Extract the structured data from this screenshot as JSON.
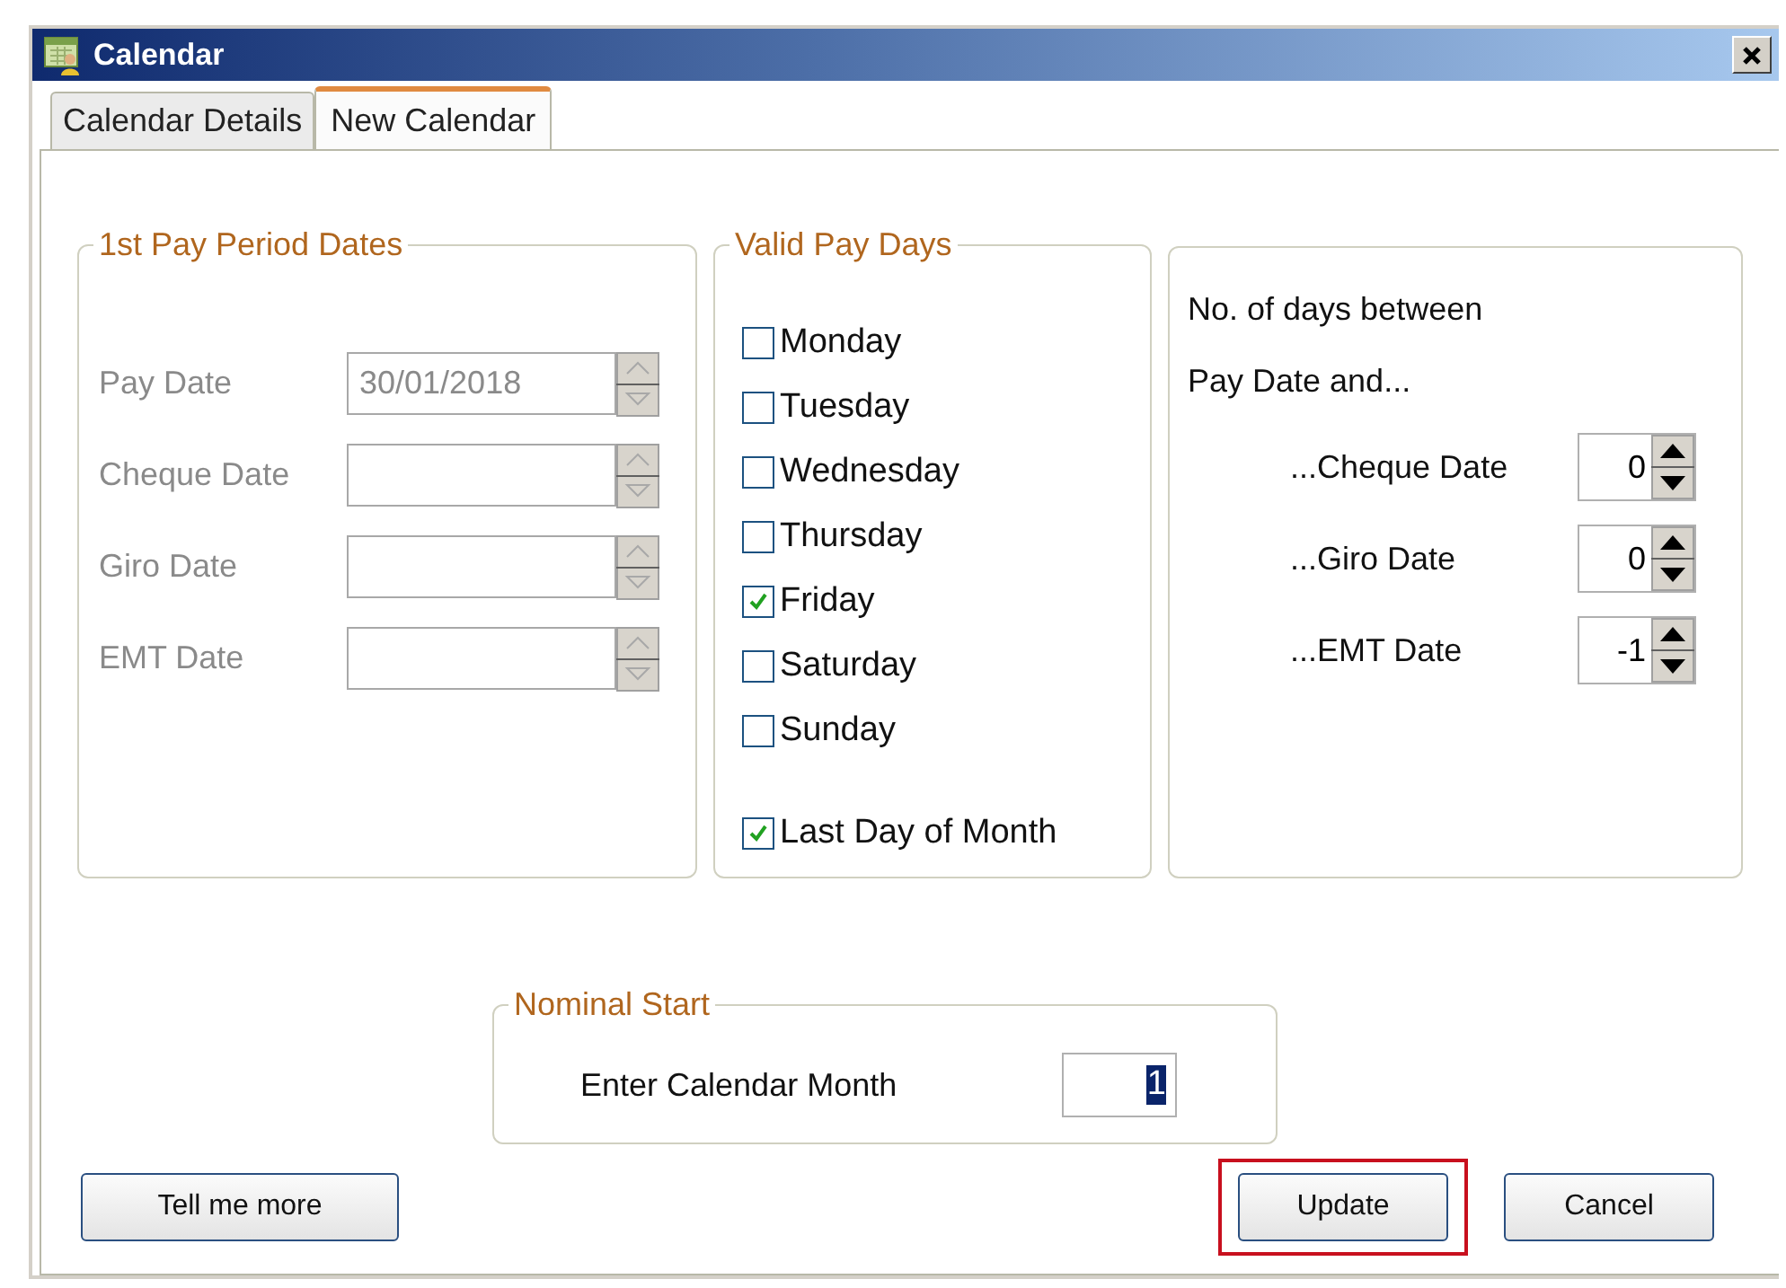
{
  "window": {
    "title": "Calendar"
  },
  "tabs": [
    {
      "label": "Calendar Details",
      "selected": false
    },
    {
      "label": "New Calendar",
      "selected": true
    }
  ],
  "pay_period": {
    "legend": "1st Pay Period Dates",
    "fields": [
      {
        "label": "Pay Date",
        "value": "30/01/2018",
        "disabled": true
      },
      {
        "label": "Cheque Date",
        "disabled": true
      },
      {
        "label": "Giro Date",
        "disabled": true
      },
      {
        "label": "EMT Date",
        "disabled": true
      }
    ]
  },
  "pay_days": {
    "legend": "Valid Pay Days",
    "options": [
      {
        "label": "Monday",
        "checked": false
      },
      {
        "label": "Tuesday",
        "checked": false
      },
      {
        "label": "Wednesday",
        "checked": false
      },
      {
        "label": "Thursday",
        "checked": false
      },
      {
        "label": "Friday",
        "checked": true
      },
      {
        "label": "Saturday",
        "checked": false
      },
      {
        "label": "Sunday",
        "checked": false
      },
      {
        "label": "Last Day of Month",
        "checked": true
      }
    ]
  },
  "offsets": {
    "heading": [
      "No. of days between",
      "Pay Date and..."
    ],
    "rows": [
      {
        "label": "...Cheque Date",
        "value": "0"
      },
      {
        "label": "...Giro Date",
        "value": "0"
      },
      {
        "label": "...EMT Date",
        "value": "-1"
      }
    ]
  },
  "nominal_start": {
    "legend": "Nominal Start",
    "label": "Enter Calendar Month",
    "value": "1",
    "selected": true
  },
  "buttons": [
    {
      "label": "Tell me more",
      "highlighted": false
    },
    {
      "label": "Update",
      "highlighted": true
    },
    {
      "label": "Cancel",
      "highlighted": false
    }
  ]
}
